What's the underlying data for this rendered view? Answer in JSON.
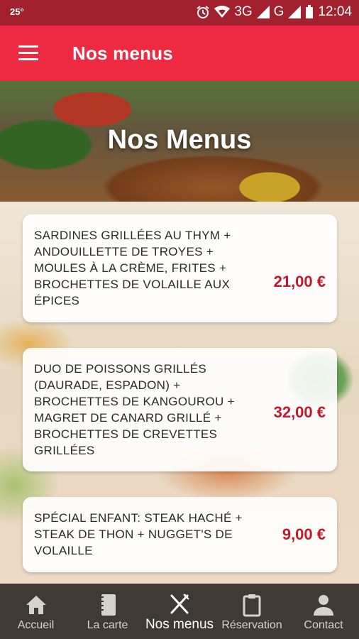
{
  "status_bar": {
    "temp": "25°",
    "network_3g": "3G",
    "network_g": "G",
    "time": "12:04"
  },
  "app_bar": {
    "title": "Nos menus"
  },
  "hero": {
    "title": "Nos Menus"
  },
  "menus": [
    {
      "description": "Sardines grillées au thym + andouillette de Troyes + moules à la crème, frites + brochettes de volaille aux épices",
      "price": "21,00 €"
    },
    {
      "description": "Duo de poissons grillés (daurade, espadon) + brochettes de kangourou + magret de canard grillé + brochettes de crevettes grillées",
      "price": "32,00 €"
    },
    {
      "description": "Spécial enfant: steak haché + steak de thon + nugget's de volaille",
      "price": "9,00 €"
    }
  ],
  "tabs": [
    {
      "label": "Accueil",
      "icon": "home-icon"
    },
    {
      "label": "La carte",
      "icon": "book-icon"
    },
    {
      "label": "Nos menus",
      "icon": "fork-knife-icon",
      "active": true
    },
    {
      "label": "Réservation",
      "icon": "clipboard-icon"
    },
    {
      "label": "Contact",
      "icon": "person-icon"
    }
  ],
  "colors": {
    "status": "#a3202e",
    "appbar": "#ee2a43",
    "price": "#c0182c",
    "tabbar": "#3f3a35"
  }
}
